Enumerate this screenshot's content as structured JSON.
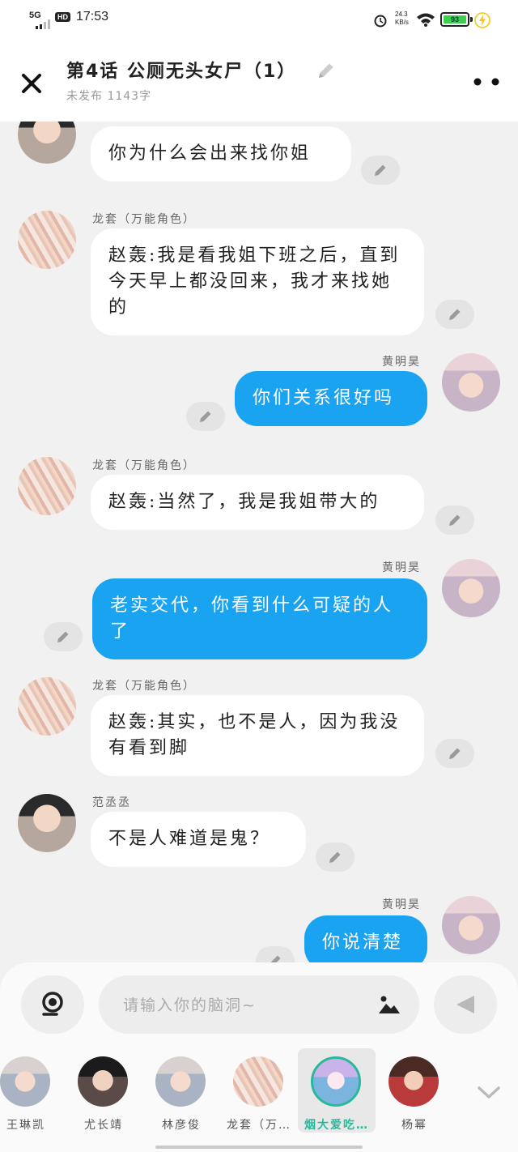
{
  "status_bar": {
    "network": "5G",
    "hd_badge": "HD",
    "time": "17:53",
    "net_speed_value": "24.3",
    "net_speed_unit": "KB/s",
    "battery_level": "93"
  },
  "header": {
    "title": "第4话  公厕无头女尸（1）",
    "subtitle": "未发布 1143字"
  },
  "messages": [
    {
      "side": "left",
      "name": "",
      "text": "你为什么会出来找你姐"
    },
    {
      "side": "left",
      "name": "龙套（万能角色）",
      "text": "赵轰:我是看我姐下班之后，直到今天早上都没回来，我才来找她的"
    },
    {
      "side": "right",
      "name": "黄明昊",
      "text": "你们关系很好吗"
    },
    {
      "side": "left",
      "name": "龙套（万能角色）",
      "text": "赵轰:当然了，我是我姐带大的"
    },
    {
      "side": "right",
      "name": "黄明昊",
      "text": "老实交代，你看到什么可疑的人了"
    },
    {
      "side": "left",
      "name": "龙套（万能角色）",
      "text": "赵轰:其实，也不是人，因为我没有看到脚"
    },
    {
      "side": "left",
      "name": "范丞丞",
      "text": "不是人难道是鬼？"
    },
    {
      "side": "right",
      "name": "黄明昊",
      "text": "你说清楚"
    }
  ],
  "composer": {
    "placeholder": "请输入你的脑洞~"
  },
  "roles": [
    {
      "label": "王琳凯",
      "active": false
    },
    {
      "label": "尤长靖",
      "active": false
    },
    {
      "label": "林彦俊",
      "active": false
    },
    {
      "label": "龙套（万…",
      "active": false
    },
    {
      "label": "烟大爱吃…",
      "active": true
    },
    {
      "label": "杨幂",
      "active": false
    }
  ],
  "colors": {
    "accent_blue": "#1aa3f0",
    "active_role": "#2bb89a",
    "battery": "#3ccf4e"
  }
}
